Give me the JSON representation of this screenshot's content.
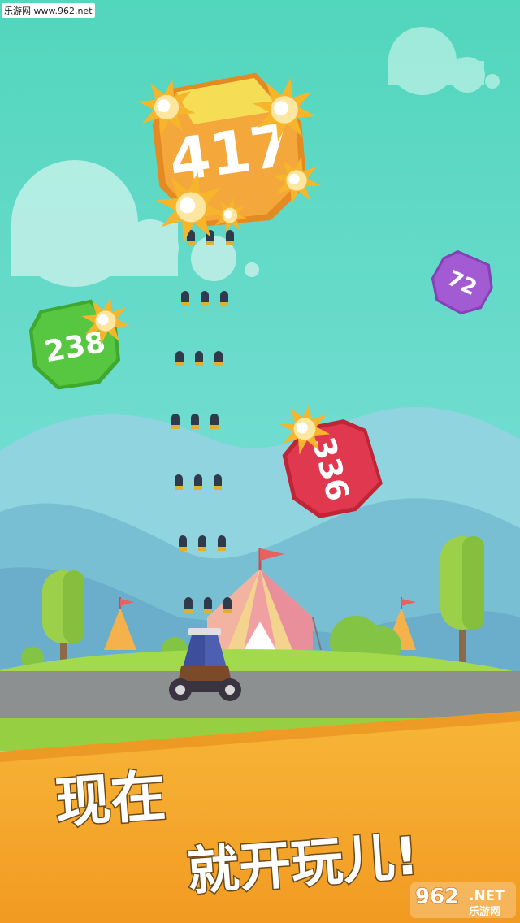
{
  "watermark": "乐游网 www.962.net",
  "blocks": [
    {
      "id": "block-417",
      "value": "417",
      "color": "#f4a73a",
      "shade": "#e48a22"
    },
    {
      "id": "block-238",
      "value": "238",
      "color": "#57c742",
      "shade": "#3fa82f"
    },
    {
      "id": "block-336",
      "value": "336",
      "color": "#e0384e",
      "shade": "#bf2437"
    },
    {
      "id": "block-72",
      "value": "72",
      "color": "#a35bd4",
      "shade": "#8541b6"
    }
  ],
  "promo": {
    "line1": "现在",
    "line2": "就开玩儿!"
  },
  "logo": {
    "number": "962",
    "net": ".NET",
    "site": "乐游网"
  },
  "colors": {
    "sky": "#5fdcc2",
    "road": "#8d9090",
    "grass": "#9fd84a",
    "banner": "#f6a52a"
  },
  "icons": [
    "cannon-icon",
    "bullet-icon",
    "tent-icon",
    "tree-icon",
    "cloud-icon",
    "explosion-icon"
  ]
}
